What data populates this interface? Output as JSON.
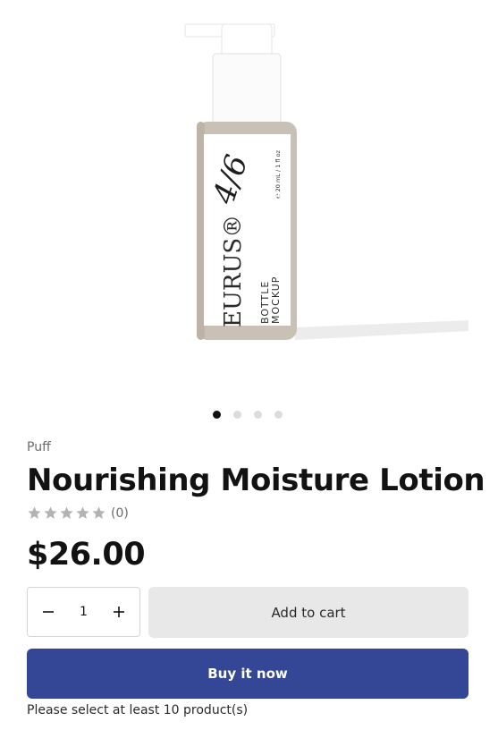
{
  "product": {
    "vendor": "Puff",
    "title": "Nourishing Moisture Lotion",
    "rating_count": "(0)",
    "rating_value": 0,
    "price": "$26.00",
    "quantity": "1",
    "add_to_cart_label": "Add to cart",
    "buy_now_label": "Buy it now",
    "min_note": "Please select at least 10 product(s)"
  },
  "image": {
    "brand": "EURUS®",
    "label_line1": "BOTTLE",
    "label_line2": "MOCKUP",
    "signature": "4/6",
    "volume": "℮ 20 mL / 1 fl oz"
  },
  "carousel": {
    "count": 4,
    "active": 0
  },
  "colors": {
    "accent": "#334796",
    "star": "#b3b3b3",
    "bottle": "#c9c1b5"
  },
  "icons": {
    "minus": "minus-icon",
    "plus": "plus-icon",
    "star": "star-icon"
  }
}
